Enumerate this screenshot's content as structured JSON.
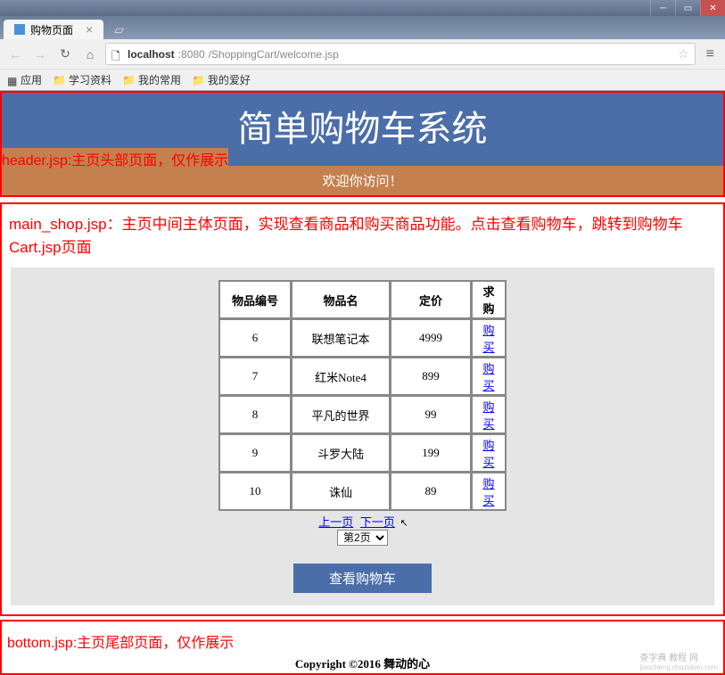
{
  "browser": {
    "tab_title": "购物页面",
    "tab_close": "×",
    "url_host": "localhost",
    "url_port": ":8080",
    "url_path": "/ShoppingCart/welcome.jsp",
    "bookmarks": {
      "apps": "应用",
      "study": "学习资料",
      "mycommon": "我的常用",
      "myhobby": "我的爱好"
    }
  },
  "header": {
    "annotation": "header.jsp:主页头部页面，仅作展示",
    "banner_title": "简单购物车系统",
    "welcome": "欢迎你访问！"
  },
  "main": {
    "annotation": "main_shop.jsp：主页中间主体页面，实现查看商品和购买商品功能。点击查看购物车，跳转到购物车Cart.jsp页面",
    "columns": {
      "id": "物品编号",
      "name": "物品名",
      "price": "定价",
      "buy": "求购",
      "buy_label": "购买"
    },
    "rows": [
      {
        "id": "6",
        "name": "联想笔记本",
        "price": "4999"
      },
      {
        "id": "7",
        "name": "红米Note4",
        "price": "899"
      },
      {
        "id": "8",
        "name": "平凡的世界",
        "price": "99"
      },
      {
        "id": "9",
        "name": "斗罗大陆",
        "price": "199"
      },
      {
        "id": "10",
        "name": "诛仙",
        "price": "89"
      }
    ],
    "pager": {
      "prev": "上一页",
      "next": "下一页",
      "select": "第2页"
    },
    "view_cart": "查看购物车"
  },
  "bottom": {
    "annotation": "bottom.jsp:主页尾部页面，仅作展示",
    "copyright": "Copyright ©2016 舞动的心"
  },
  "watermark": {
    "main": "查字典 教程 网",
    "sub": "jiaocheng.chazidian.com"
  }
}
